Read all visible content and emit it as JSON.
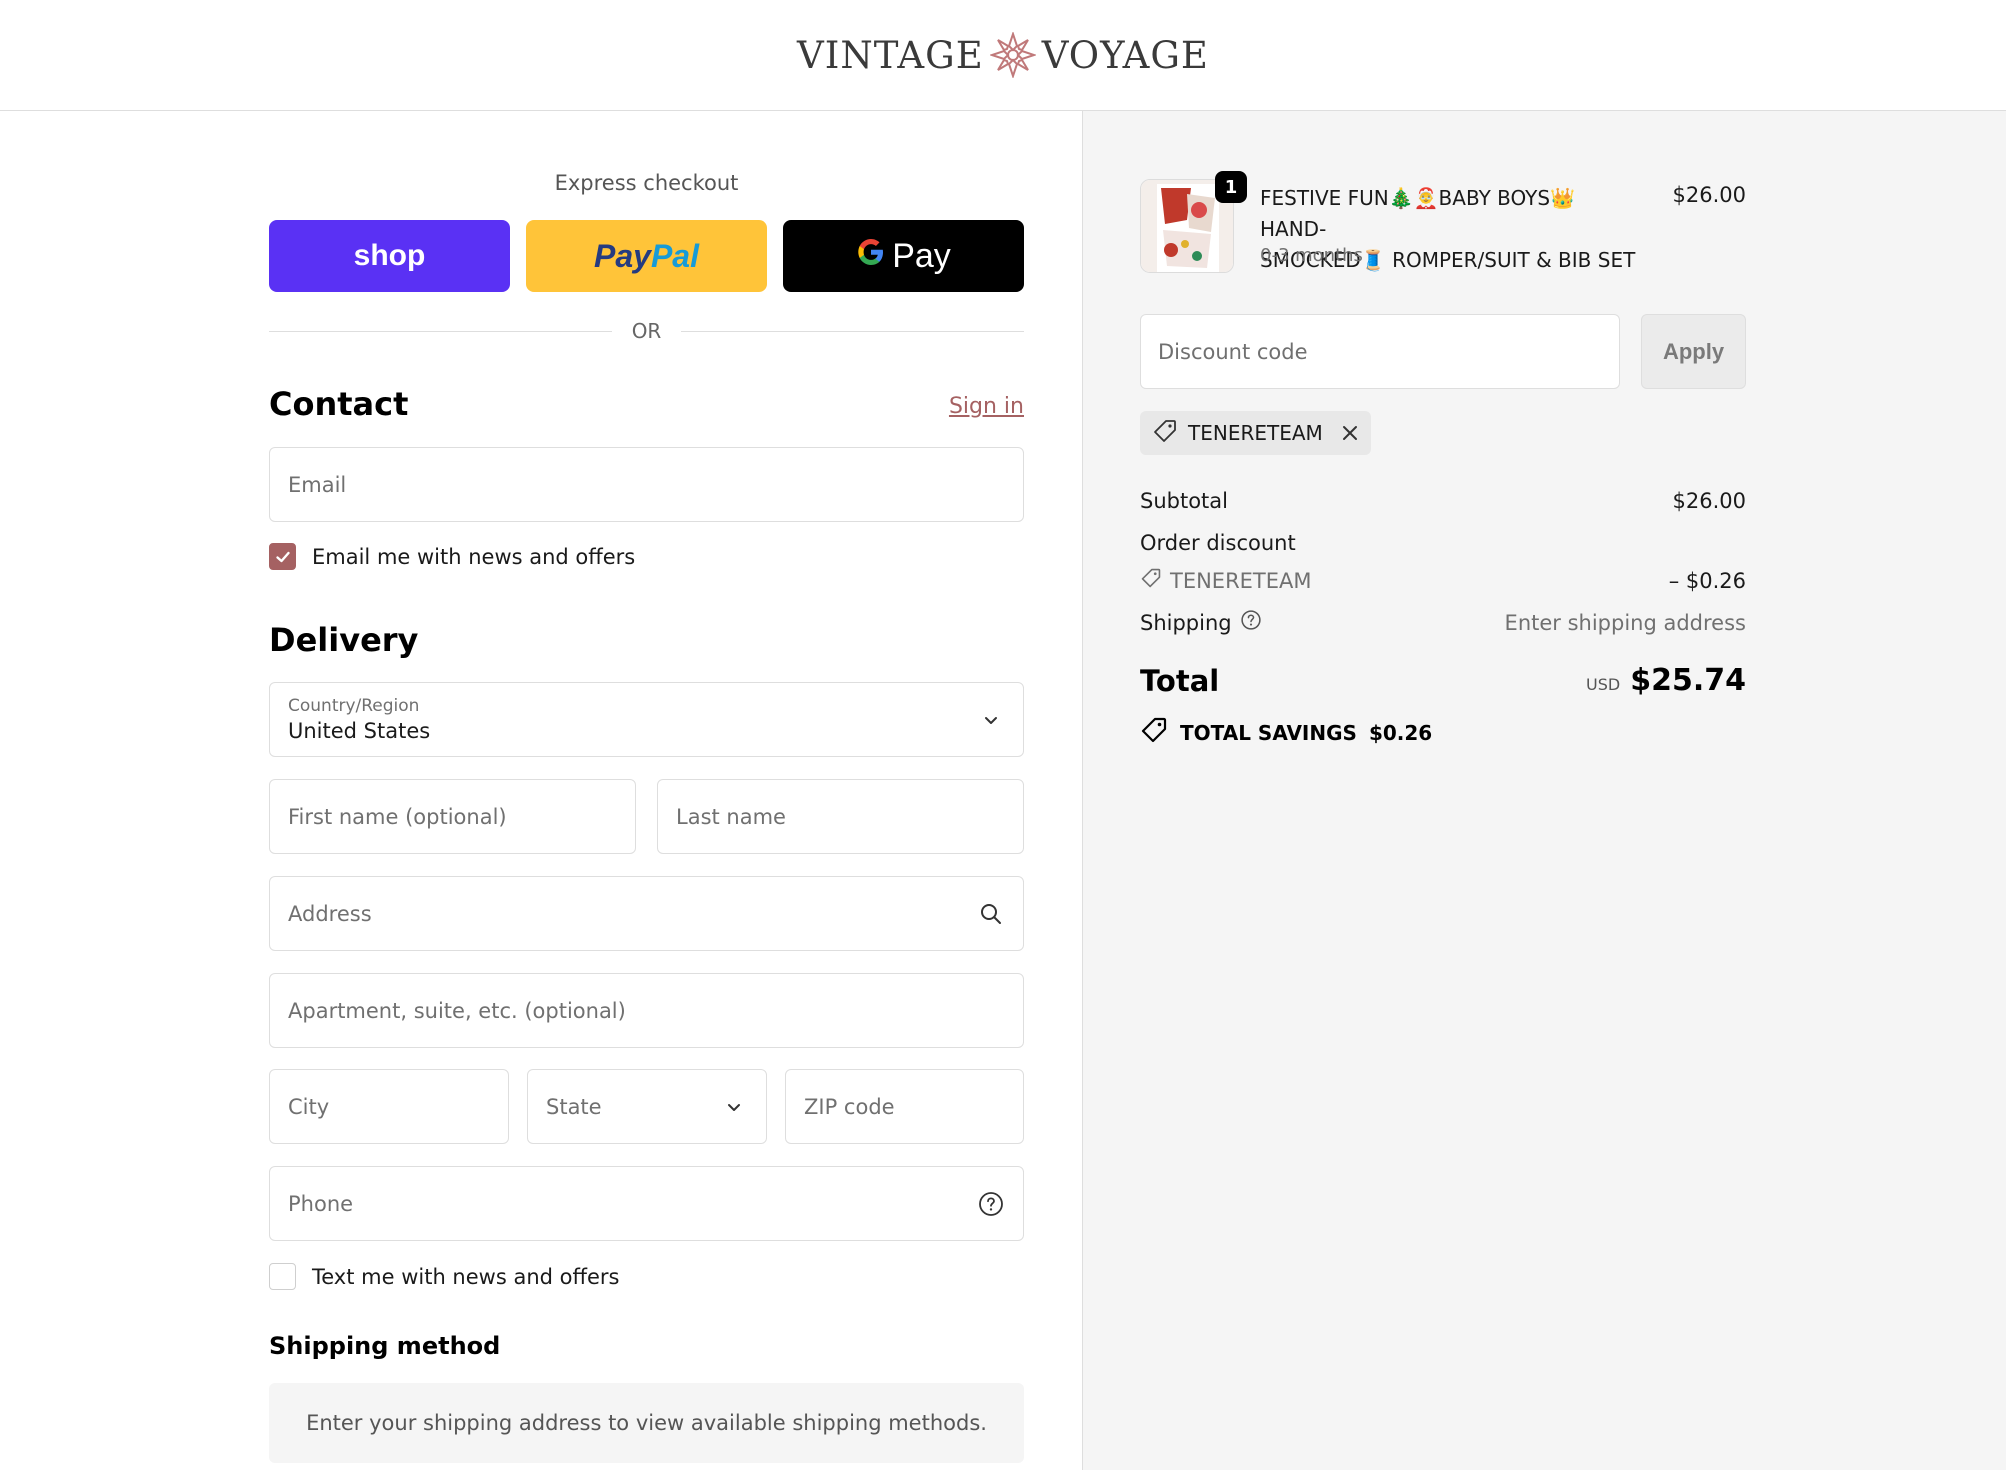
{
  "brand": {
    "left": "VINTAGE",
    "right": "VOYAGE"
  },
  "express": {
    "title": "Express checkout",
    "shop_label": "shop",
    "paypal_a": "Pay",
    "paypal_b": "Pal",
    "gpay_label": "Pay",
    "or_label": "OR"
  },
  "contact": {
    "title": "Contact",
    "sign_in": "Sign in",
    "email_placeholder": "Email",
    "news_label": "Email me with news and offers",
    "news_checked": true
  },
  "delivery": {
    "title": "Delivery",
    "country_label": "Country/Region",
    "country_value": "United States",
    "first_name": "First name (optional)",
    "last_name": "Last name",
    "address": "Address",
    "apartment": "Apartment, suite, etc. (optional)",
    "city": "City",
    "state": "State",
    "zip": "ZIP code",
    "phone": "Phone",
    "text_label": "Text me with news and offers",
    "text_checked": false
  },
  "shipping_method": {
    "title": "Shipping method",
    "note": "Enter your shipping address to view available shipping methods."
  },
  "cart": {
    "qty": "1",
    "name_line1": "FESTIVE FUN🎄🤶BABY BOYS👑HAND-",
    "name_line2": "SMOCKED🧵 ROMPER/SUIT & BIB SET",
    "variant": "0-3 months",
    "price": "$26.00"
  },
  "discount": {
    "placeholder": "Discount code",
    "apply": "Apply",
    "applied_code": "TENERETEAM"
  },
  "summary": {
    "subtotal_label": "Subtotal",
    "subtotal_value": "$26.00",
    "order_discount_label": "Order discount",
    "discount_code": "TENERETEAM",
    "discount_value": "– $0.26",
    "shipping_label": "Shipping",
    "shipping_value": "Enter shipping address",
    "total_label": "Total",
    "currency": "USD",
    "total_value": "$25.74",
    "savings_label": "TOTAL SAVINGS",
    "savings_value": "$0.26"
  },
  "watermark": "Tenereteam",
  "colors": {
    "accent": "#a56162",
    "shop": "#5a31f4",
    "paypal": "#ffc439",
    "gpay": "#000000"
  }
}
